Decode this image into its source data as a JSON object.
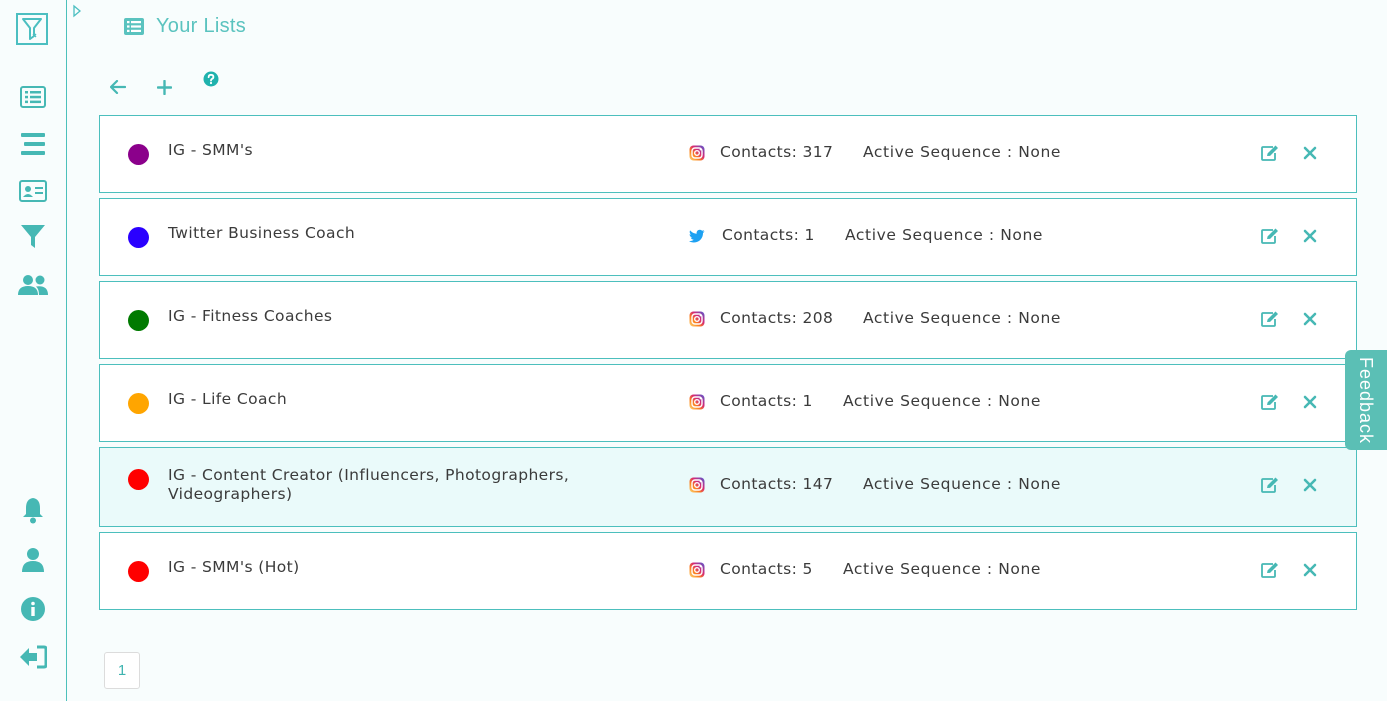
{
  "header": {
    "title": "Your Lists"
  },
  "lists": [
    {
      "name": "IG - SMM's",
      "color": "#8b008b",
      "platform": "instagram",
      "contacts": "Contacts: 317",
      "sequence": "Active Sequence : None"
    },
    {
      "name": "Twitter Business Coach",
      "color": "#2a00ff",
      "platform": "twitter",
      "contacts": "Contacts: 1",
      "sequence": "Active Sequence : None"
    },
    {
      "name": "IG - Fitness Coaches",
      "color": "#007a00",
      "platform": "instagram",
      "contacts": "Contacts: 208",
      "sequence": "Active Sequence : None"
    },
    {
      "name": "IG - Life Coach",
      "color": "#ffa500",
      "platform": "instagram",
      "contacts": "Contacts: 1",
      "sequence": "Active Sequence : None"
    },
    {
      "name": "IG - Content Creator (Influencers, Photographers, Videographers)",
      "color": "#ff0000",
      "platform": "instagram",
      "contacts": "Contacts: 147",
      "sequence": "Active Sequence : None"
    },
    {
      "name": "IG - SMM's (Hot)",
      "color": "#ff0000",
      "platform": "instagram",
      "contacts": "Contacts: 5",
      "sequence": "Active Sequence : None"
    }
  ],
  "pagination": {
    "current": "1"
  },
  "feedback": {
    "label": "Feedback"
  },
  "colors": {
    "accent": "#4cbfbd",
    "instagram": "#c13584",
    "twitter": "#1da1f2"
  },
  "icons": {
    "sidebar_top": [
      "lists-icon",
      "menu-bars-icon",
      "contact-card-icon",
      "funnel-icon",
      "users-icon"
    ],
    "sidebar_bottom": [
      "bell-icon",
      "user-icon",
      "info-icon",
      "logout-icon"
    ],
    "toolbar": [
      "back-arrow-icon",
      "plus-icon",
      "help-icon"
    ]
  }
}
